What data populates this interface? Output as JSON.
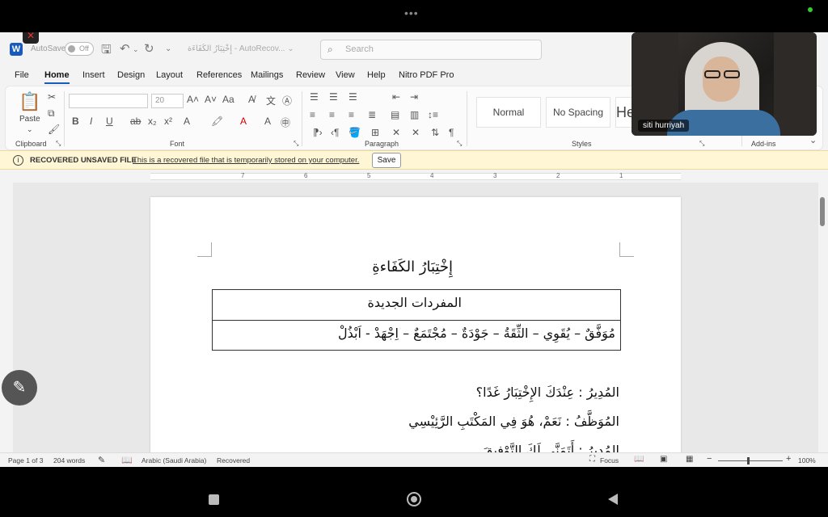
{
  "device": {
    "top_dots": "•••"
  },
  "titlebar": {
    "app_icon": "word-logo",
    "autosave_label": "AutoSave",
    "autosave_state": "Off",
    "doc_title": "إِخْتِبَارُ الكَفَاءَة  -  AutoRecov...  ⌄",
    "search_placeholder": "Search"
  },
  "menu": [
    "File",
    "Home",
    "Insert",
    "Design",
    "Layout",
    "References",
    "Mailings",
    "Review",
    "View",
    "Help",
    "Nitro PDF Pro"
  ],
  "ribbon": {
    "clipboard_label": "Clipboard",
    "paste_label": "Paste",
    "font_label": "Font",
    "font_size": "20",
    "paragraph_label": "Paragraph",
    "styles_label": "Styles",
    "addins_label": "Add-ins",
    "styles": [
      "Normal",
      "No Spacing",
      "He"
    ]
  },
  "infobar": {
    "title": "RECOVERED UNSAVED FILE",
    "message": "This is a recovered file that is temporarily stored on your computer.",
    "save_label": "Save"
  },
  "ruler": {
    "numbers": [
      "7",
      "6",
      "5",
      "4",
      "3",
      "2",
      "1"
    ]
  },
  "document": {
    "heading": "إِخْتِبَارُ الكَفَاءةِ",
    "table_header": "المفردات الجديدة",
    "vocab": "مُوَفَّقٌ – يُقَوِي – الثِّقَةُ – جَوْدَةٌ – مُجْتَمَعٌ – اِجْهَدْ - اَبْذُلْ",
    "line1": "المُدِيرُ    :  عِنْدَكَ الإِخْتِبَارُ غَدًا؟",
    "line2": "المُوَظَّفُ : نَعَمْ، هُوَ فِي المَكْتَبِ الرَّئِيْسِي",
    "line3": "المُدِيرُ    :  أَتَمَنَّى لَكَ التَّوْفِيقَ"
  },
  "statusbar": {
    "page": "Page 1 of 3",
    "words": "204 words",
    "language": "Arabic (Saudi Arabia)",
    "recovered": "Recovered",
    "focus": "Focus",
    "zoom": "100%"
  },
  "video": {
    "participant_name": "siti hurriyah"
  }
}
